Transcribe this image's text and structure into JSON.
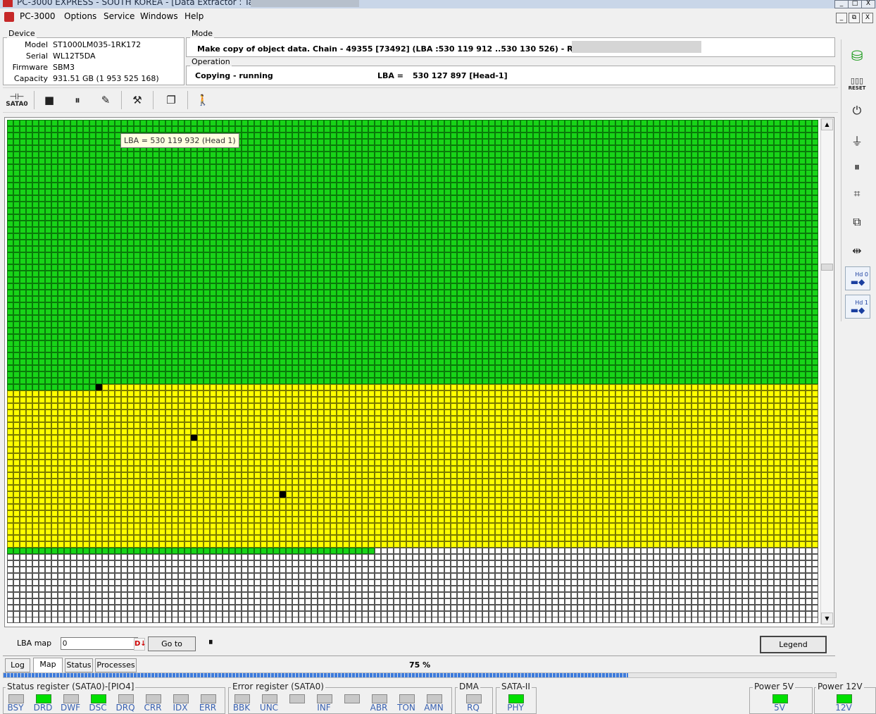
{
  "window": {
    "title": "PC-3000 EXPRESS - SOUTH KOREA - [Data Extractor : Task - '",
    "controls": [
      "_",
      "□",
      "X"
    ]
  },
  "menu": {
    "items": [
      "PC-3000",
      "Options",
      "Service",
      "Windows",
      "Help"
    ]
  },
  "mdi_controls": [
    "_",
    "⧉",
    "X"
  ],
  "device": {
    "title": "Device",
    "model_label": "Model",
    "model": "ST1000LM035-1RK172",
    "serial_label": "Serial",
    "serial": "WL12T5DA",
    "firmware_label": "Firmware",
    "firmware": "SBM3",
    "capacity_label": "Capacity",
    "capacity": "931.51 GB (1 953 525 168)"
  },
  "mode": {
    "title": "Mode",
    "text": "Make copy of object data. Chain - 49355 [73492] (LBA :530 119 912 ..530 130 526) - Root\\사:"
  },
  "operation": {
    "title": "Operation",
    "status": "Copying - running",
    "lba_label": "LBA =",
    "lba_value": "530 127 897  [Head-1]"
  },
  "toolbar": {
    "sata_label": "SATA0",
    "buttons": [
      "sata-port",
      "stop",
      "pause",
      "edit-task",
      "tools",
      "copy-windows",
      "walk-disabled"
    ]
  },
  "map": {
    "columns": 128,
    "rows": 80,
    "block_states": {
      "full_green_rows": 42,
      "row42_green_count": 15,
      "yellow_until_row": 68,
      "final_green_row": 68,
      "final_green_count": 58,
      "black_blocks": [
        [
          42,
          14
        ],
        [
          50,
          29
        ],
        [
          59,
          43
        ]
      ]
    },
    "colors": {
      "copied": "#18d418",
      "pending": "#ffff00",
      "unread": "#ffffff",
      "error": "#000000"
    },
    "tooltip": "LBA =  530 119 932 (Head 1)"
  },
  "lba_map": {
    "label": "LBA map",
    "value": "0",
    "goto_label": "Go to",
    "legend_label": "Legend"
  },
  "tabs": [
    {
      "label": "Log",
      "active": false
    },
    {
      "label": "Map",
      "active": true
    },
    {
      "label": "Status",
      "active": false
    },
    {
      "label": "Processes",
      "active": false
    }
  ],
  "progress": {
    "percent_text": "75 %",
    "value": 0.75
  },
  "status_register": {
    "title": "Status register (SATA0)-[PIO4]",
    "bits": [
      {
        "name": "BSY",
        "on": false
      },
      {
        "name": "DRD",
        "on": true
      },
      {
        "name": "DWF",
        "on": false
      },
      {
        "name": "DSC",
        "on": true
      },
      {
        "name": "DRQ",
        "on": false
      },
      {
        "name": "CRR",
        "on": false
      },
      {
        "name": "IDX",
        "on": false
      },
      {
        "name": "ERR",
        "on": false
      }
    ]
  },
  "error_register": {
    "title": "Error register (SATA0)",
    "bits": [
      {
        "name": "BBK",
        "on": false
      },
      {
        "name": "UNC",
        "on": false
      },
      {
        "name": "",
        "on": false
      },
      {
        "name": "INF",
        "on": false
      },
      {
        "name": "",
        "on": false
      },
      {
        "name": "ABR",
        "on": false
      },
      {
        "name": "TON",
        "on": false
      },
      {
        "name": "AMN",
        "on": false
      }
    ]
  },
  "dma": {
    "title": "DMA",
    "bit": "RQ",
    "on": false
  },
  "sata2": {
    "title": "SATA-II",
    "bit": "PHY",
    "on": true
  },
  "power5": {
    "title": "Power 5V",
    "bit": "5V",
    "on": true
  },
  "power12": {
    "title": "Power 12V",
    "bit": "12V",
    "on": true
  },
  "sidebar": {
    "reset_label": "RESET",
    "hd0_label": "Hd 0",
    "hd1_label": "Hd 1"
  }
}
